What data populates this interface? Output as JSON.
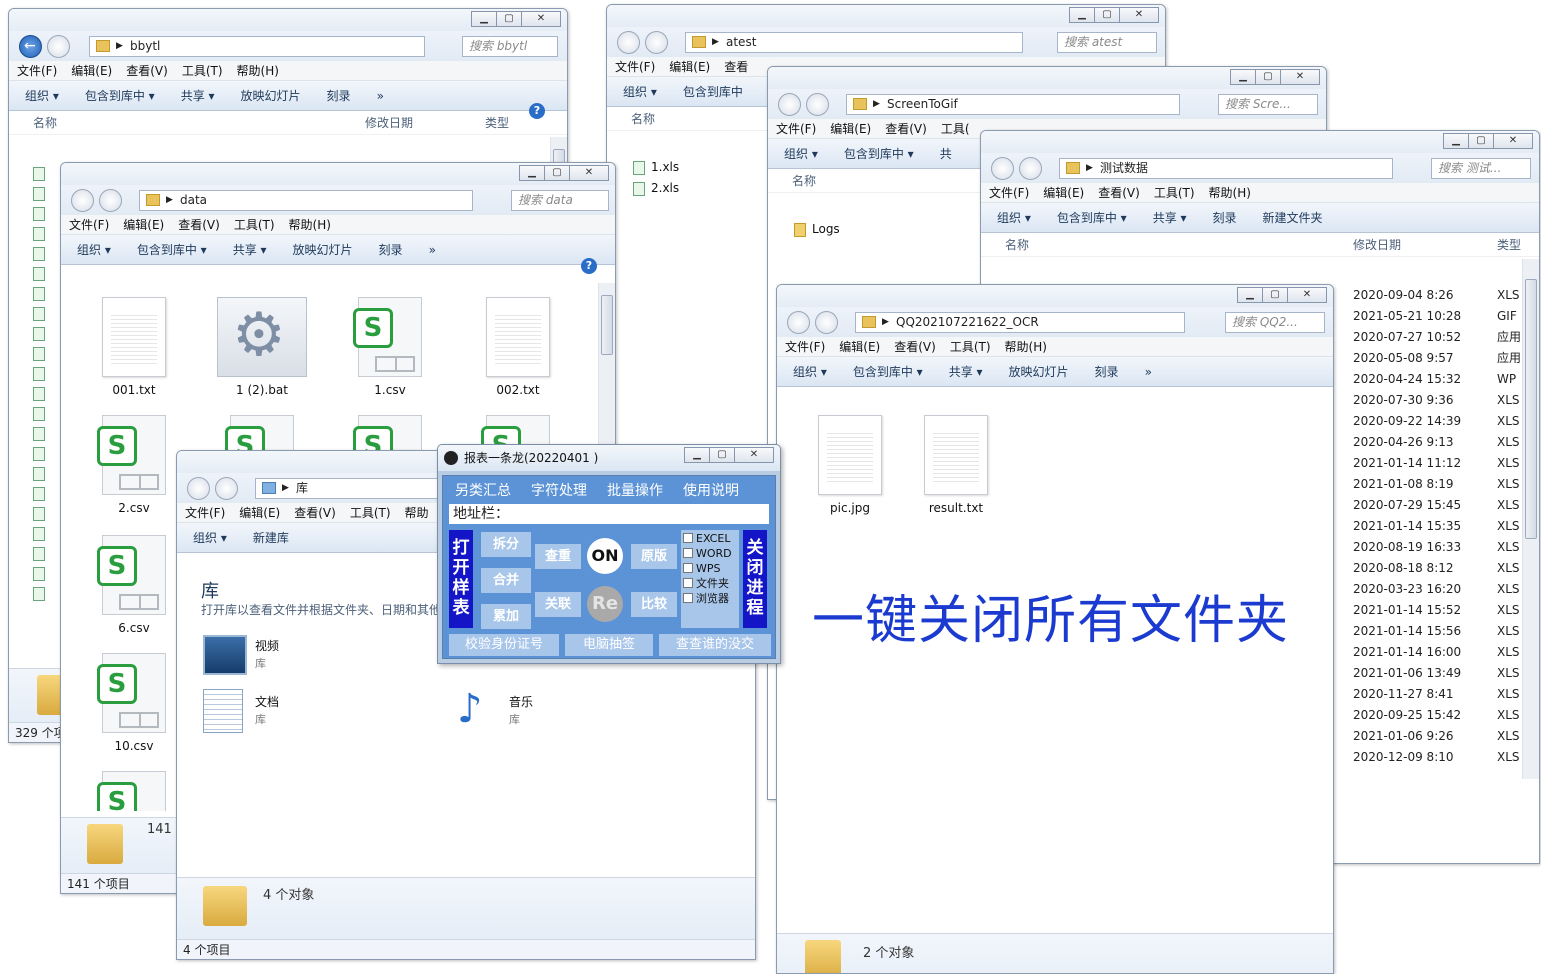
{
  "w1": {
    "addr": "bbytl",
    "search": "搜索 bbytl",
    "menu": [
      "文件(F)",
      "编辑(E)",
      "查看(V)",
      "工具(T)",
      "帮助(H)"
    ],
    "cmd": [
      "组织 ▾",
      "包含到库中 ▾",
      "共享 ▾",
      "放映幻灯片",
      "刻录",
      "»"
    ],
    "col_name": "名称",
    "col_date": "修改日期",
    "col_type": "类型",
    "status": "329 个项"
  },
  "w2": {
    "addr": "data",
    "search": "搜索 data",
    "menu": [
      "文件(F)",
      "编辑(E)",
      "查看(V)",
      "工具(T)",
      "帮助(H)"
    ],
    "cmd": [
      "组织 ▾",
      "包含到库中 ▾",
      "共享 ▾",
      "放映幻灯片",
      "刻录",
      "»"
    ],
    "files": [
      "001.txt",
      "1 (2).bat",
      "1.csv",
      "002.txt",
      "2.csv",
      "6.csv",
      "10.csv"
    ],
    "count": "141",
    "status": "141 个项目"
  },
  "w3": {
    "addr": "库",
    "menu": [
      "文件(F)",
      "编辑(E)",
      "查看(V)",
      "工具(T)",
      "帮助"
    ],
    "cmd": [
      "组织 ▾",
      "新建库"
    ],
    "heading": "库",
    "desc": "打开库以查看文件并根据文件夹、日期和其他",
    "libs": [
      {
        "name": "视频",
        "sub": "库"
      },
      {
        "name": "文档",
        "sub": "库"
      },
      {
        "name": "音乐",
        "sub": "库"
      }
    ],
    "count": "4 个对象",
    "status": "4 个项目"
  },
  "w4": {
    "addr": "atest",
    "search": "搜索 atest",
    "menu": [
      "文件(F)",
      "编辑(E)",
      "查看"
    ],
    "cmd": [
      "组织 ▾",
      "包含到库中"
    ],
    "col_name": "名称",
    "files": [
      "1.xls",
      "2.xls"
    ]
  },
  "w5": {
    "addr": "ScreenToGif",
    "search": "搜索 Scre...",
    "menu": [
      "文件(F)",
      "编辑(E)",
      "查看(V)",
      "工具("
    ],
    "cmd": [
      "组织 ▾",
      "包含到库中 ▾",
      "共"
    ],
    "col_name": "名称",
    "files": [
      "Logs"
    ]
  },
  "w6": {
    "addr": "测试数据",
    "search": "搜索 测试...",
    "menu": [
      "文件(F)",
      "编辑(E)",
      "查看(V)",
      "工具(T)",
      "帮助(H)"
    ],
    "cmd": [
      "组织 ▾",
      "包含到库中 ▾",
      "共享 ▾",
      "刻录",
      "新建文件夹"
    ],
    "col_name": "名称",
    "col_date": "修改日期",
    "col_type": "类型",
    "rows": [
      [
        "2020-09-04 8:26",
        "XLS"
      ],
      [
        "2021-05-21 10:28",
        "GIF"
      ],
      [
        "2020-07-27 10:52",
        "应用"
      ],
      [
        "2020-05-08 9:57",
        "应用"
      ],
      [
        "2020-04-24 15:32",
        "WP"
      ],
      [
        "2020-07-30 9:36",
        "XLS"
      ],
      [
        "2020-09-22 14:39",
        "XLS"
      ],
      [
        "2020-04-26 9:13",
        "XLS"
      ],
      [
        "2021-01-14 11:12",
        "XLS"
      ],
      [
        "2021-01-08 8:19",
        "XLS"
      ],
      [
        "2020-07-29 15:45",
        "XLS"
      ],
      [
        "2021-01-14 15:35",
        "XLS"
      ],
      [
        "2020-08-19 16:33",
        "XLS"
      ],
      [
        "2020-08-18 8:12",
        "XLS"
      ],
      [
        "2020-03-23 16:20",
        "XLS"
      ],
      [
        "2021-01-14 15:52",
        "XLS"
      ],
      [
        "2021-01-14 15:56",
        "XLS"
      ],
      [
        "2021-01-14 16:00",
        "XLS"
      ],
      [
        "2021-01-06 13:49",
        "XLS"
      ],
      [
        "2020-11-27 8:41",
        "XLS"
      ],
      [
        "2020-09-25 15:42",
        "XLS"
      ],
      [
        "2021-01-06 9:26",
        "XLS"
      ],
      [
        "2020-12-09 8:10",
        "XLS"
      ]
    ]
  },
  "w7": {
    "addr": "QQ202107221622_OCR",
    "search": "搜索 QQ2...",
    "menu": [
      "文件(F)",
      "编辑(E)",
      "查看(V)",
      "工具(T)",
      "帮助(H)"
    ],
    "cmd": [
      "组织 ▾",
      "包含到库中 ▾",
      "共享 ▾",
      "放映幻灯片",
      "刻录",
      "»"
    ],
    "files": [
      "pic.jpg",
      "result.txt"
    ],
    "count": "2 个对象"
  },
  "app": {
    "title": "报表一条龙(20220401 )",
    "menu": [
      "另类汇总",
      "字符处理",
      "批量操作",
      "使用说明"
    ],
    "addr_label": "地址栏：",
    "open": "打开样表",
    "close": "关闭进程",
    "b_split": "拆分",
    "b_merge": "合并",
    "b_acc": "累加",
    "b_dup": "查重",
    "b_link": "关联",
    "b_on": "ON",
    "b_re": "Re",
    "b_orig": "原版",
    "b_cmp": "比较",
    "checks": [
      "EXCEL",
      "WORD",
      "WPS",
      "文件夹",
      "浏览器"
    ],
    "bottom": [
      "校验身份证号",
      "电脑抽签",
      "查查谁的没交"
    ]
  },
  "banner": "一键关闭所有文件夹",
  "colors": {
    "accent": "#1a3ad0",
    "app_panel": "#5b93d6",
    "app_vertical": "#1515c8"
  }
}
